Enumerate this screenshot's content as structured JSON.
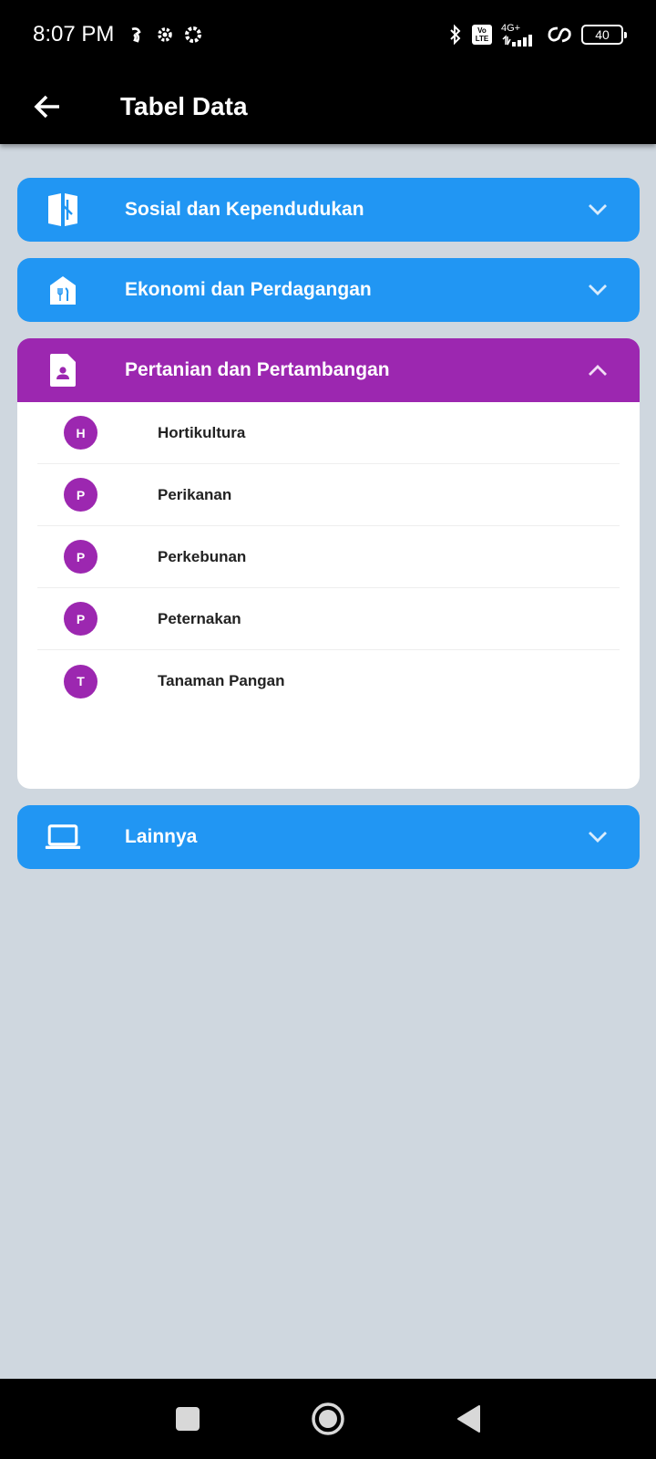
{
  "status_bar": {
    "time": "8:07 PM",
    "network_label": "4G+",
    "volte_label": "Vo LTE",
    "battery_level": "40"
  },
  "app_bar": {
    "title": "Tabel Data"
  },
  "colors": {
    "collapsed_panel": "#2196f3",
    "expanded_panel": "#9c27b0",
    "background": "#cfd7df"
  },
  "panels": [
    {
      "title": "Sosial dan Kependudukan",
      "icon": "book-icon",
      "expanded": false
    },
    {
      "title": "Ekonomi dan Perdagangan",
      "icon": "store-icon",
      "expanded": false
    },
    {
      "title": "Pertanian dan Pertambangan",
      "icon": "contact-document-icon",
      "expanded": true,
      "items": [
        {
          "initial": "H",
          "label": "Hortikultura"
        },
        {
          "initial": "P",
          "label": "Perikanan"
        },
        {
          "initial": "P",
          "label": "Perkebunan"
        },
        {
          "initial": "P",
          "label": "Peternakan"
        },
        {
          "initial": "T",
          "label": "Tanaman Pangan"
        }
      ]
    },
    {
      "title": "Lainnya",
      "icon": "laptop-icon",
      "expanded": false
    }
  ],
  "nav_bar": {
    "buttons": [
      "recents-button",
      "home-button",
      "back-button"
    ]
  }
}
